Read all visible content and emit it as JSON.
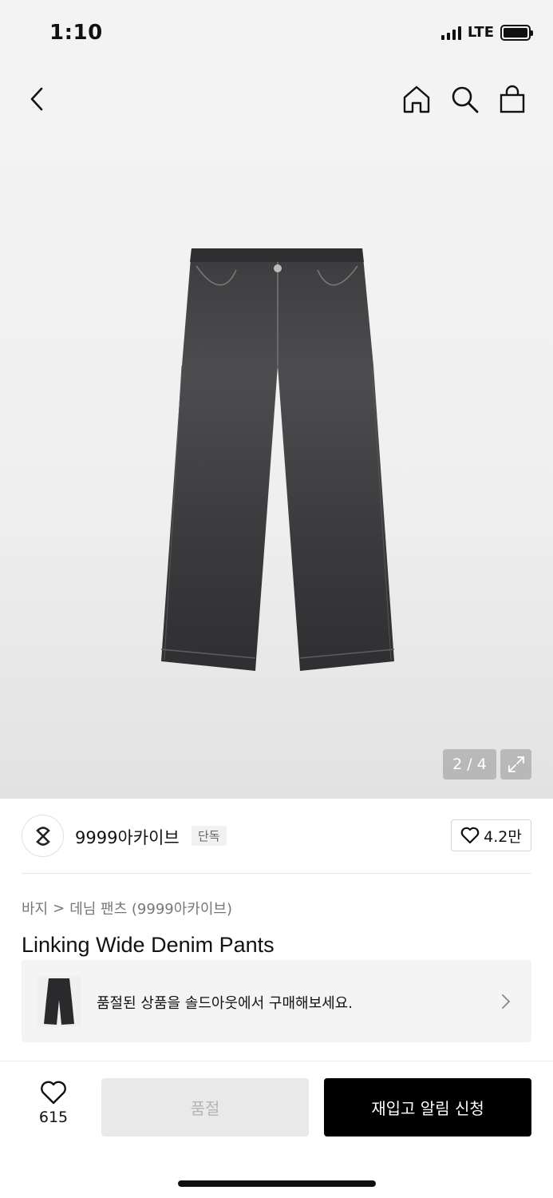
{
  "status_bar": {
    "time": "1:10",
    "network": "LTE"
  },
  "nav": {
    "icons": [
      "back-arrow-icon",
      "home-icon",
      "search-icon",
      "shopping-bag-icon"
    ]
  },
  "gallery": {
    "counter": "2 / 4",
    "image": "black-wide-denim-pants"
  },
  "brand": {
    "name": "9999아카이브",
    "badge": "단독",
    "likes": "4.2만"
  },
  "breadcrumb": {
    "category": "바지",
    "separator": ">",
    "subcategory": "데님 팬츠 (9999아카이브)"
  },
  "product": {
    "title": "Linking Wide Denim Pants"
  },
  "soldout_banner": {
    "text": "품절된 상품을 솔드아웃에서 구매해보세요."
  },
  "bottom_bar": {
    "wish_count": "615",
    "soldout_label": "품절",
    "restock_label": "재입고 알림 신청"
  },
  "colors": {
    "primary_button": "#000000",
    "disabled_button": "#e9e9e9",
    "background_gray": "#f3f3f3"
  }
}
